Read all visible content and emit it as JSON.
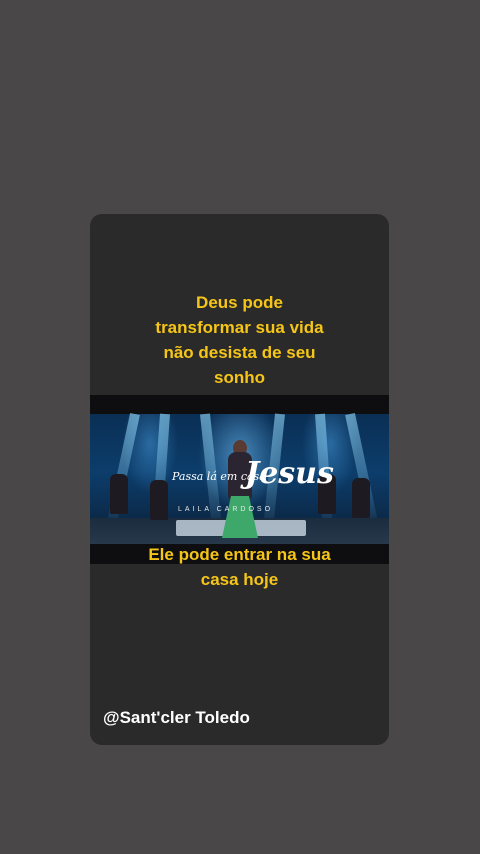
{
  "story": {
    "top_caption": [
      "Deus pode",
      "transformar sua vida",
      "não desista de seu",
      "sonho"
    ],
    "bottom_caption": [
      "Ele pode entrar na sua",
      "casa hoje"
    ],
    "handle": "@Sant'cler Toledo"
  },
  "video": {
    "logo_script": "Passa lá em casa",
    "logo_title": "Jesus",
    "logo_subtitle": "LAILA CARDOSO"
  },
  "colors": {
    "background": "#4a4749",
    "card": "#2b2a2b",
    "caption": "#f5c518"
  }
}
